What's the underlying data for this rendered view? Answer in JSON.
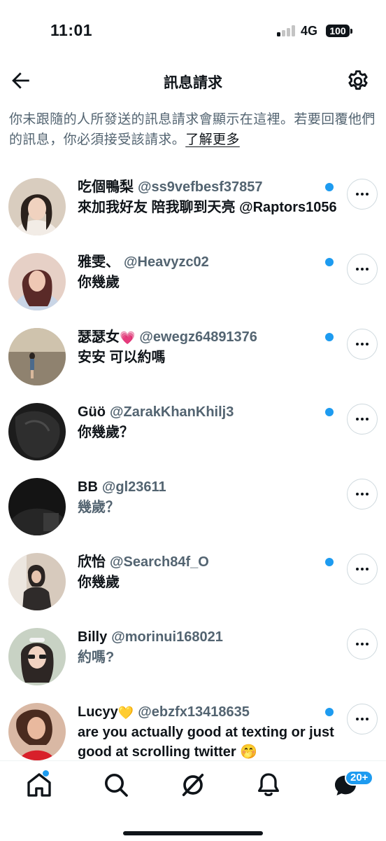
{
  "status_bar": {
    "time": "11:01",
    "network": "4G",
    "battery": "100"
  },
  "header": {
    "title": "訊息請求",
    "back_icon": "arrow-left-icon",
    "settings_icon": "gear-icon"
  },
  "info": {
    "text": "你未跟隨的人所發送的訊息請求會顯示在這裡。若要回覆他們的訊息，你必須接受該請求。",
    "link": "了解更多"
  },
  "requests": [
    {
      "name": "吃個鴨梨",
      "emoji": "",
      "handle": "@ss9vefbesf37857",
      "message": "來加我好友 陪我聊到天亮 @Raptors1056",
      "message_emoji": "",
      "unread": true
    },
    {
      "name": "雅雯、",
      "emoji": "",
      "handle": "@Heavyzc02",
      "message": "你幾歲",
      "message_emoji": "",
      "unread": true
    },
    {
      "name": "瑟瑟女",
      "emoji": "💗",
      "handle": "@ewegz64891376",
      "message": "安安 可以約嗎",
      "message_emoji": "",
      "unread": true
    },
    {
      "name": "Güö",
      "emoji": "",
      "handle": "@ZarakKhanKhilj3",
      "message": "你幾歲？",
      "message_emoji": "",
      "unread": true
    },
    {
      "name": "BB",
      "emoji": "",
      "handle": "@gl23611",
      "message": "幾歲？",
      "message_emoji": "",
      "unread": false
    },
    {
      "name": "欣怡",
      "emoji": "",
      "handle": "@Search84f_O",
      "message": "你幾歲",
      "message_emoji": "",
      "unread": true
    },
    {
      "name": "Billy",
      "emoji": "",
      "handle": "@morinui168021",
      "message": "約嗎?",
      "message_emoji": "",
      "unread": false
    },
    {
      "name": "Lucyy",
      "emoji": "💛",
      "handle": "@ebzfx13418635",
      "message": "are you actually good at texting or just good at scrolling twitter",
      "message_emoji": "🤭",
      "unread": true
    }
  ],
  "bottom_nav": {
    "items": [
      "home-icon",
      "search-icon",
      "grok-icon",
      "bell-icon",
      "messages-icon"
    ],
    "messages_badge": "20+"
  },
  "colors": {
    "accent": "#1d9bf0",
    "text": "#0f1419",
    "secondary": "#536471",
    "border": "#cfd9de"
  }
}
